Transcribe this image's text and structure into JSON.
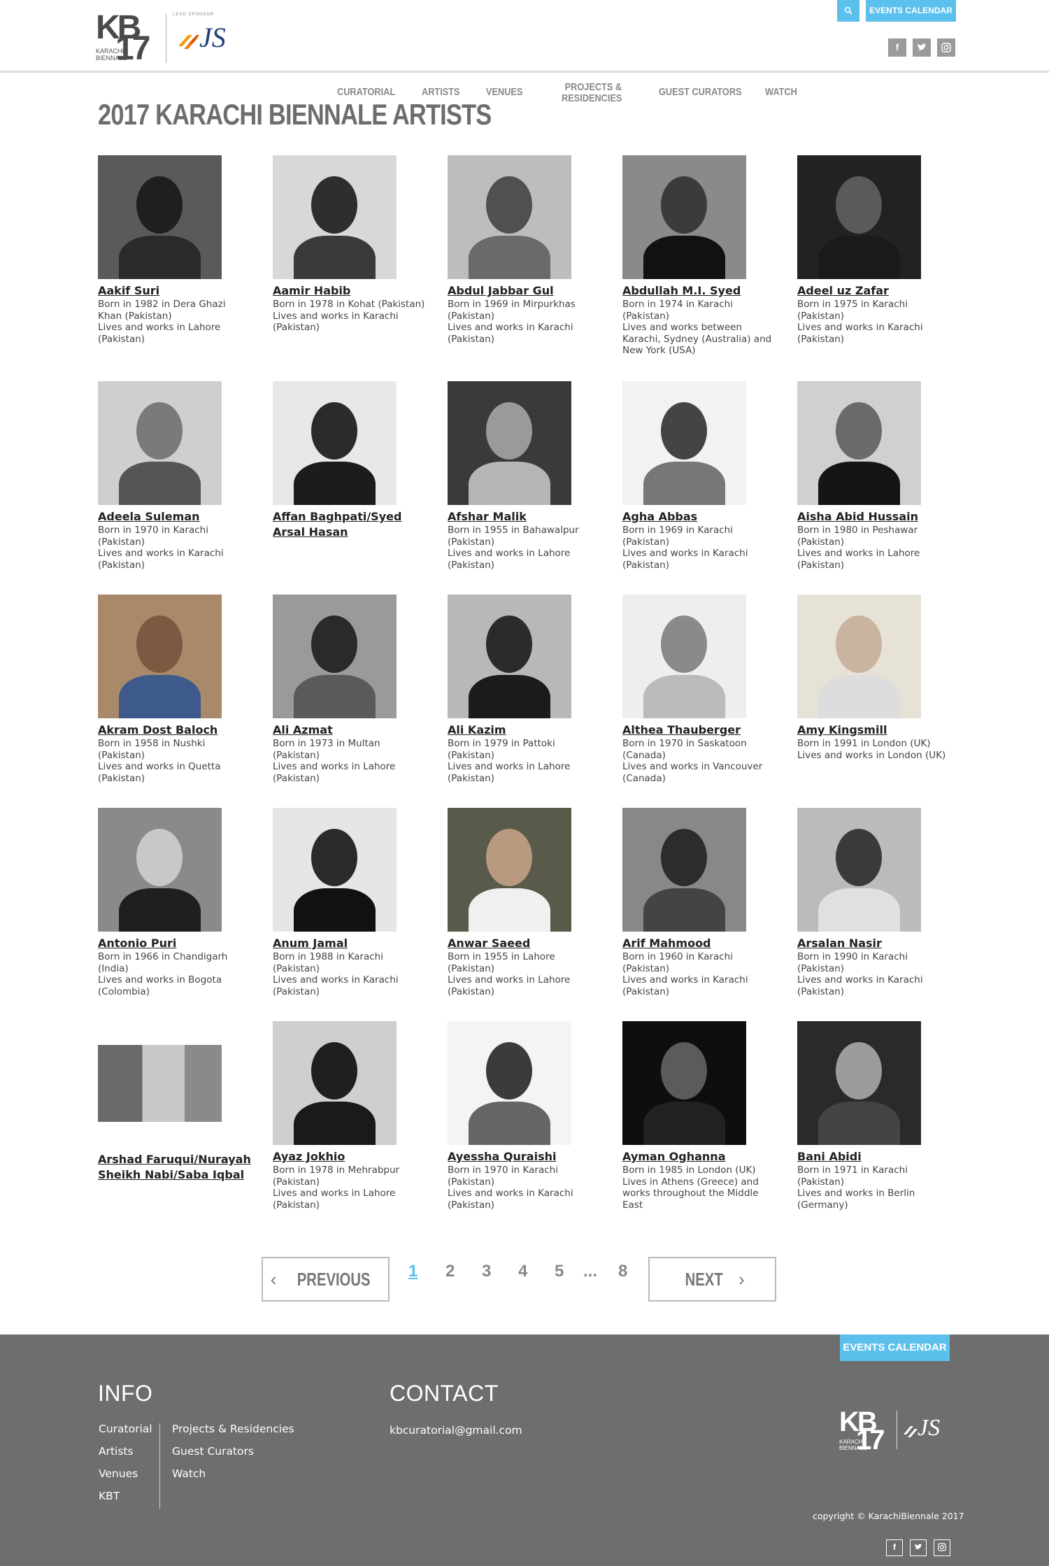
{
  "header": {
    "logo": {
      "kb": "KB",
      "num": "17",
      "biennale_line1": "KARACHI",
      "biennale_line2": "BIENNALE",
      "sponsor": "LEAD SPONSOR",
      "sponsor_name": "JS"
    },
    "search_icon": "search-icon",
    "events_calendar": "EVENTS CALENDAR",
    "nav": [
      {
        "label": "CURATORIAL"
      },
      {
        "label": "ARTISTS"
      },
      {
        "label": "VENUES"
      },
      {
        "label_line1": "PROJECTS &",
        "label_line2": "RESIDENCIES"
      },
      {
        "label": "GUEST CURATORS"
      },
      {
        "label": "WATCH"
      }
    ],
    "social": [
      "f",
      "t",
      "i"
    ]
  },
  "main": {
    "title": "2017 KARACHI BIENNALE ARTISTS",
    "artists": [
      {
        "name": "Aakif Suri",
        "info": "Born in 1982 in Dera Ghazi\nKhan (Pakistan)\nLives and works in Lahore\n(Pakistan)"
      },
      {
        "name": "Aamir Habib",
        "info": "Born in 1978 in Kohat (Pakistan)\nLives and works in Karachi\n(Pakistan)"
      },
      {
        "name": "Abdul Jabbar Gul",
        "info": "Born in 1969 in Mirpurkhas\n(Pakistan)\nLives and works in Karachi\n(Pakistan)"
      },
      {
        "name": "Abdullah M.I. Syed",
        "info": "Born in 1974 in Karachi\n(Pakistan)\nLives and works between\nKarachi, Sydney (Australia) and\nNew York (USA)"
      },
      {
        "name": "Adeel uz Zafar",
        "info": "Born in 1975 in Karachi\n(Pakistan)\nLives and works in Karachi\n(Pakistan)"
      },
      {
        "name": "Adeela Suleman",
        "info": "Born in 1970 in Karachi\n(Pakistan)\nLives and works in Karachi\n(Pakistan)"
      },
      {
        "name": "Affan Baghpati/Syed Arsal Hasan",
        "info": ""
      },
      {
        "name": "Afshar Malik",
        "info": "Born in 1955 in Bahawalpur\n(Pakistan)\nLives and works in Lahore\n(Pakistan)"
      },
      {
        "name": "Agha Abbas",
        "info": "Born in 1969 in Karachi\n(Pakistan)\nLives and works in Karachi\n(Pakistan)"
      },
      {
        "name": "Aisha Abid Hussain",
        "info": "Born in 1980 in Peshawar\n(Pakistan)\nLives and works in Lahore\n(Pakistan)"
      },
      {
        "name": "Akram Dost Baloch",
        "info": "Born in 1958 in Nushki\n(Pakistan)\nLives and works in Quetta\n(Pakistan)"
      },
      {
        "name": "Ali Azmat",
        "info": "Born in 1973 in Multan\n(Pakistan)\nLives and works in Lahore\n(Pakistan)"
      },
      {
        "name": "Ali Kazim",
        "info": "Born in 1979 in Pattoki\n(Pakistan)\nLives and works in Lahore\n(Pakistan)"
      },
      {
        "name": "Althea Thauberger",
        "info": "Born in 1970 in Saskatoon\n(Canada)\nLives and works in Vancouver\n(Canada)"
      },
      {
        "name": "Amy Kingsmill",
        "info": "Born in 1991 in London (UK)\nLives and works in London (UK)"
      },
      {
        "name": "Antonio Puri",
        "info": "Born in 1966 in Chandigarh\n(India)\nLives and works in Bogota\n(Colombia)"
      },
      {
        "name": "Anum Jamal",
        "info": "Born in 1988 in Karachi\n(Pakistan)\nLives and works in Karachi\n(Pakistan)"
      },
      {
        "name": "Anwar Saeed",
        "info": "Born in 1955 in Lahore\n(Pakistan)\nLives and works in Lahore\n(Pakistan)"
      },
      {
        "name": "Arif Mahmood",
        "info": "Born in 1960 in Karachi\n(Pakistan)\nLives and works in Karachi\n(Pakistan)"
      },
      {
        "name": "Arsalan Nasir",
        "info": "Born in 1990 in Karachi\n(Pakistan)\nLives and works in Karachi\n(Pakistan)"
      },
      {
        "name": "Arshad Faruqui/Nurayah Sheikh Nabi/Saba Iqbal",
        "info": ""
      },
      {
        "name": "Ayaz Jokhio",
        "info": "Born in 1978 in Mehrabpur\n(Pakistan)\nLives and works in Lahore\n(Pakistan)"
      },
      {
        "name": "Ayessha Quraishi",
        "info": "Born in 1970 in Karachi\n(Pakistan)\nLives and works in Karachi\n(Pakistan)"
      },
      {
        "name": "Ayman Oghanna",
        "info": "Born in 1985 in London (UK)\nLives in Athens (Greece) and\nworks throughout the Middle\nEast"
      },
      {
        "name": "Bani Abidi",
        "info": "Born in 1971 in Karachi\n(Pakistan)\nLives and works in Berlin\n(Germany)"
      }
    ]
  },
  "pagination": {
    "previous": "PREVIOUS",
    "next": "NEXT",
    "pages": [
      "1",
      "2",
      "3",
      "4",
      "5",
      "...",
      "8"
    ],
    "current": "1"
  },
  "footer": {
    "events_calendar": "EVENTS CALENDAR",
    "info_heading": "INFO",
    "contact_heading": "CONTACT",
    "info_links_col1": [
      "Curatorial",
      "Artists",
      "Venues",
      "KBT"
    ],
    "info_links_col2": [
      "Projects & Residencies",
      "Guest Curators",
      "Watch"
    ],
    "email": "kbcuratorial@gmail.com",
    "copyright": "copyright © KarachiBiennale 2017",
    "logo": {
      "kb": "KB",
      "num": "17",
      "biennale_line1": "KARACHI",
      "biennale_line2": "BIENNALE",
      "sponsor_name": "JS"
    }
  }
}
